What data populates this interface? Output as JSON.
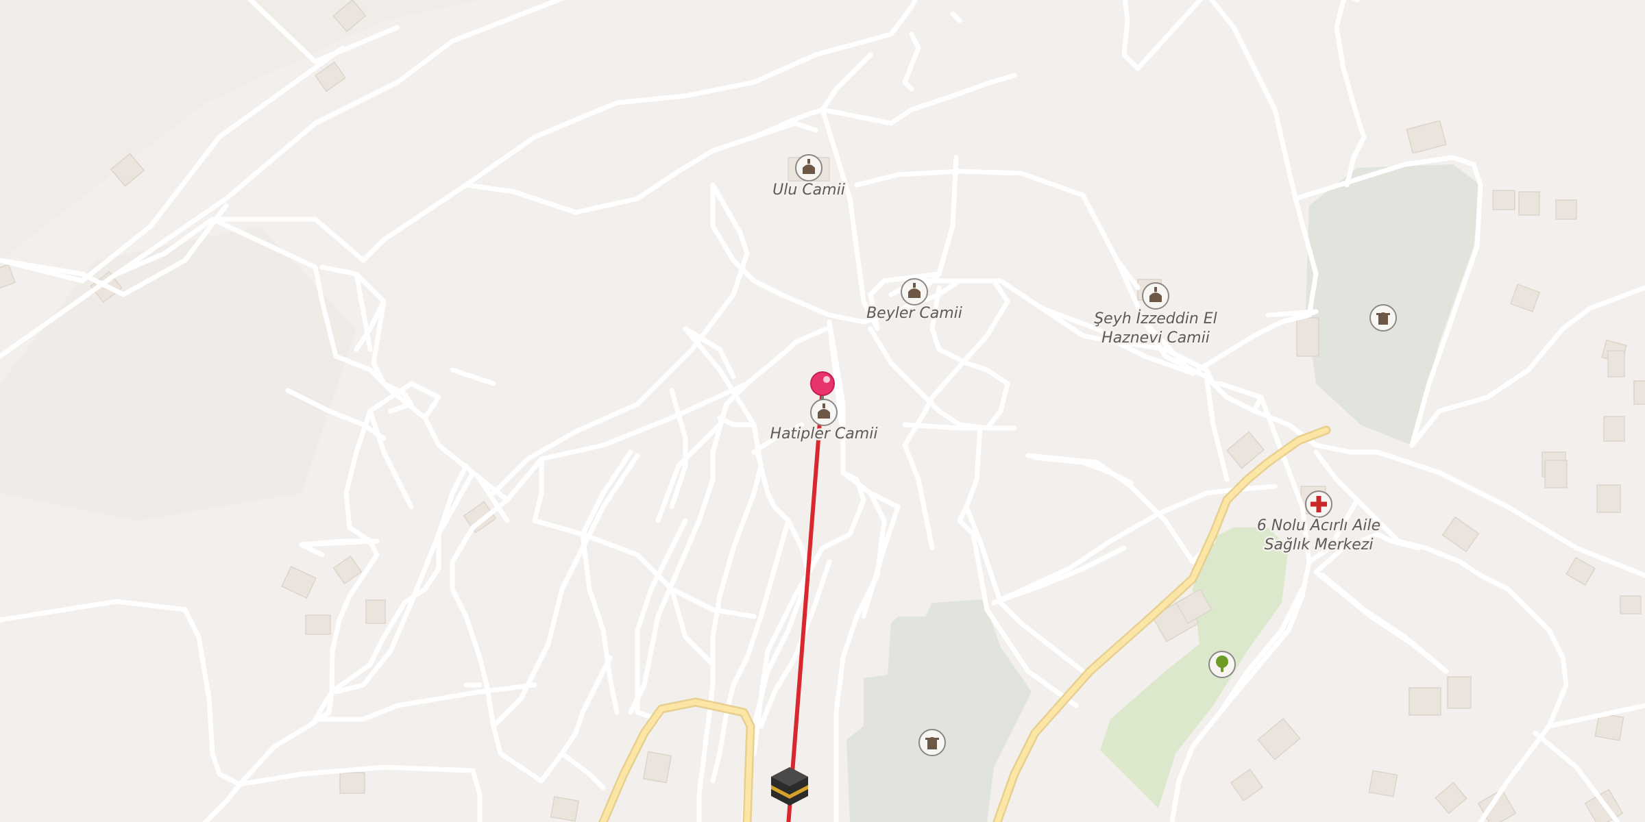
{
  "map": {
    "poi": [
      {
        "id": "ulu-camii",
        "label": "Ulu Camii",
        "icon": "mosque-icon"
      },
      {
        "id": "beyler-camii",
        "label": "Beyler Camii",
        "icon": "mosque-icon"
      },
      {
        "id": "seyh-izzeddin",
        "label_line1": "Şeyh İzzeddin El",
        "label_line2": "Haznevi Camii",
        "icon": "mosque-icon"
      },
      {
        "id": "hatipler-camii",
        "label": "Hatipler Camii",
        "icon": "mosque-icon"
      },
      {
        "id": "saglik-merkezi",
        "label_line1": "6 Nolu Acırlı Aile",
        "label_line2": "Sağlık Merkezi",
        "icon": "hospital-icon"
      },
      {
        "id": "cemetery-east",
        "icon": "cemetery-icon"
      },
      {
        "id": "cemetery-south",
        "icon": "cemetery-icon"
      },
      {
        "id": "park",
        "icon": "tree-icon"
      }
    ],
    "markers": [
      {
        "id": "location-pin",
        "icon": "pin-icon",
        "color": "#e8336b"
      },
      {
        "id": "kaaba",
        "icon": "kaaba-icon"
      }
    ],
    "qibla_line_color": "#d9272e",
    "colors": {
      "background": "#f2efec",
      "road": "#ffffff",
      "major_road": "#fbe6a6",
      "cemetery": "#e1e4dd",
      "park": "#dbe8cc",
      "building": "#ebe4dd"
    }
  }
}
